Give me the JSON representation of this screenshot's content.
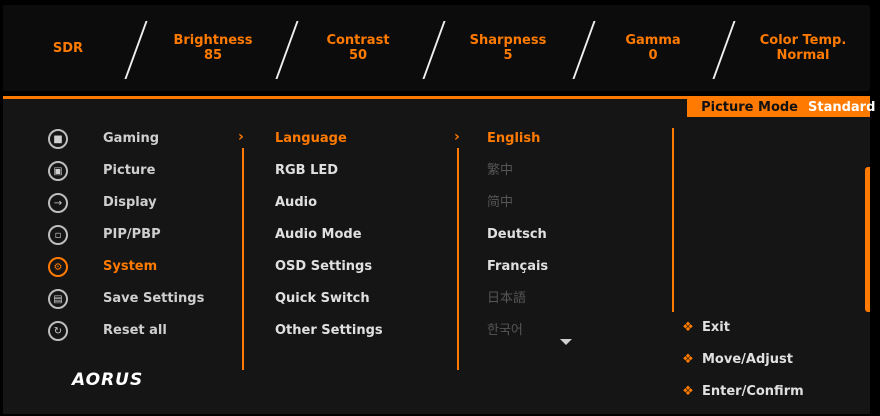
{
  "status_bar": {
    "sdr": "SDR",
    "brightness_label": "Brightness",
    "brightness_value": "85",
    "contrast_label": "Contrast",
    "contrast_value": "50",
    "sharpness_label": "Sharpness",
    "sharpness_value": "5",
    "gamma_label": "Gamma",
    "gamma_value": "0",
    "colortemp_label": "Color Temp.",
    "colortemp_value": "Normal"
  },
  "picture_mode": {
    "label": "Picture Mode",
    "value": "Standard"
  },
  "main_menu": [
    {
      "label": "Gaming",
      "icon": "gamepad-icon"
    },
    {
      "label": "Picture",
      "icon": "picture-icon"
    },
    {
      "label": "Display",
      "icon": "display-input-icon"
    },
    {
      "label": "PIP/PBP",
      "icon": "pip-icon"
    },
    {
      "label": "System",
      "icon": "gear-icon"
    },
    {
      "label": "Save Settings",
      "icon": "save-icon"
    },
    {
      "label": "Reset all",
      "icon": "reset-icon"
    }
  ],
  "system_menu": [
    "Language",
    "RGB LED",
    "Audio",
    "Audio Mode",
    "OSD Settings",
    "Quick Switch",
    "Other Settings"
  ],
  "language_options": [
    "English",
    "繁中",
    "简中",
    "Deutsch",
    "Français",
    "日本語",
    "한국어"
  ],
  "hints": {
    "exit": "Exit",
    "move": "Move/Adjust",
    "enter": "Enter/Confirm"
  },
  "logo": "AORUS",
  "colors": {
    "accent": "#ff7a00",
    "background": "#000000",
    "panel": "#151515"
  }
}
